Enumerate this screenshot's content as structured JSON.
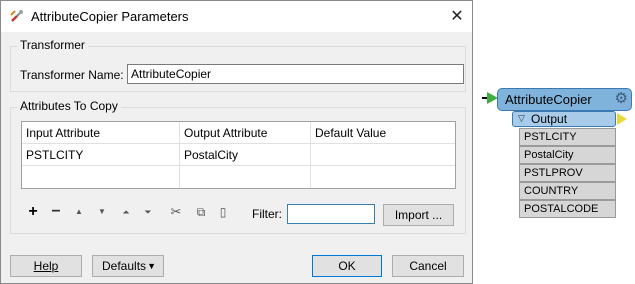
{
  "dialog": {
    "title": "AttributeCopier Parameters",
    "close_symbol": "✕",
    "transformer_group": {
      "title": "Transformer",
      "name_label": "Transformer Name:",
      "name_value": "AttributeCopier"
    },
    "attributes_group": {
      "title": "Attributes To Copy",
      "columns": [
        "Input Attribute",
        "Output Attribute",
        "Default Value"
      ],
      "rows": [
        [
          "PSTLCITY",
          "PostalCity",
          ""
        ],
        [
          "",
          "",
          ""
        ]
      ]
    },
    "toolbar": {
      "icons": [
        "plus-icon",
        "minus-icon",
        "move-up-icon",
        "move-down-icon",
        "move-top-icon",
        "move-bottom-icon",
        "cut-icon",
        "copy-icon",
        "paste-icon"
      ],
      "filter_label": "Filter:",
      "filter_value": "",
      "import_label": "Import ..."
    },
    "buttons": {
      "help": "Help",
      "defaults": "Defaults",
      "ok": "OK",
      "cancel": "Cancel"
    }
  },
  "canvas": {
    "transformer": {
      "title": "AttributeCopier",
      "port_label": "Output",
      "attributes": [
        "PSTLCITY",
        "PostalCity",
        "PSTLPROV",
        "COUNTRY",
        "POSTALCODE"
      ],
      "colors": {
        "header": "#7fb3dc",
        "port": "#a9cbea",
        "input_arrow": "#3fae3f",
        "output_arrow": "#e6d93a",
        "attribute_bg": "#d6d6d6"
      }
    }
  }
}
